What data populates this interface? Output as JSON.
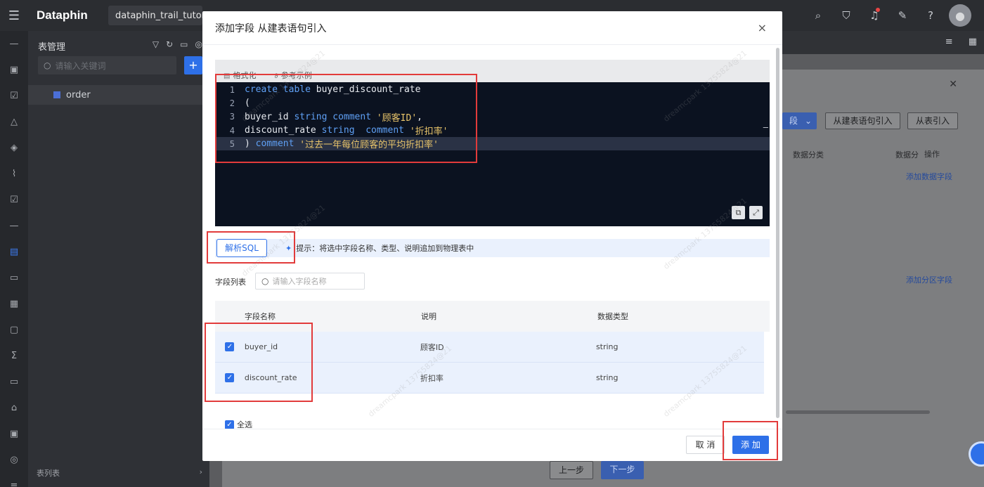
{
  "topbar": {
    "logo": "Dataphin",
    "project": "dataphin_trail_tutorial"
  },
  "sidepanel": {
    "title": "表管理",
    "search_placeholder": "请输入关键词",
    "add_label": "+",
    "tree_item": "order",
    "footer_label": "表列表",
    "footer_arrow": "›"
  },
  "background": {
    "btn_field": "段",
    "btn_from_sql": "从建表语句引入",
    "btn_from_table": "从表引入",
    "col_data_class": "数据分类",
    "col_data_class2": "数据分",
    "col_ops": "操作",
    "link_add_data_field": "添加数据字段",
    "link_add_partition_field": "添加分区字段",
    "btn_prev": "上一步",
    "btn_next": "下一步"
  },
  "modal": {
    "title": "添加字段 从建表语句引入",
    "close": "×",
    "toolbar": {
      "format": "格式化",
      "example": "参考示例"
    },
    "code_lines": [
      {
        "n": "1",
        "parts": [
          [
            "kw",
            "create table "
          ],
          [
            "id",
            "buyer_discount_rate"
          ]
        ]
      },
      {
        "n": "2",
        "parts": [
          [
            "id",
            "("
          ]
        ]
      },
      {
        "n": "3",
        "parts": [
          [
            "id",
            "buyer_id "
          ],
          [
            "kw",
            "string comment "
          ],
          [
            "str",
            "'顾客ID'"
          ],
          [
            "id",
            ","
          ]
        ]
      },
      {
        "n": "4",
        "parts": [
          [
            "id",
            "discount_rate "
          ],
          [
            "kw",
            "string  comment "
          ],
          [
            "str",
            "'折扣率'"
          ]
        ]
      },
      {
        "n": "5",
        "parts": [
          [
            "id",
            ") "
          ],
          [
            "kw",
            "comment "
          ],
          [
            "str",
            "'过去一年每位顾客的平均折扣率'"
          ]
        ]
      }
    ],
    "parse_button": "解析SQL",
    "tip": "提示：将选中字段名称、类型、说明追加到物理表中",
    "field_list_label": "字段列表",
    "field_search_placeholder": "请输入字段名称",
    "table": {
      "headers": [
        "字段名称",
        "说明",
        "数据类型"
      ],
      "rows": [
        {
          "name": "buyer_id",
          "desc": "顾客ID",
          "type": "string",
          "checked": true
        },
        {
          "name": "discount_rate",
          "desc": "折扣率",
          "type": "string",
          "checked": true
        }
      ]
    },
    "select_all": "全选",
    "cancel": "取 消",
    "add": "添 加"
  },
  "colors": {
    "primary": "#2e70e8",
    "highlight_box": "#e23b3b",
    "editor_bg": "#0b1220"
  }
}
